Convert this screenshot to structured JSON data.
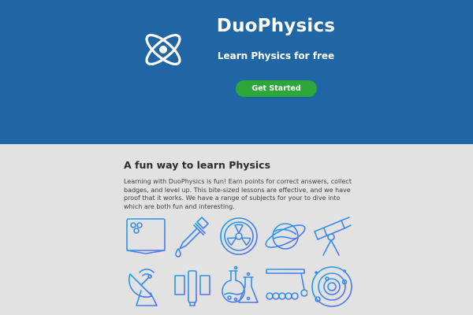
{
  "hero": {
    "brand": "DuoPhysics",
    "tagline": "Learn Physics for free",
    "cta_label": "Get Started",
    "logo_icon": "atom-icon"
  },
  "content": {
    "title": "A fun way to learn Physics",
    "intro": "Learning with DuoPhysics is fun! Earn points for correct answers, collect badges, and level up. This bite-sized lessons are effective, and we have proof that it works. We have a range of subjects for your to dive into which are both fun and interesting."
  },
  "icons": [
    "open-book-icon",
    "dropper-icon",
    "radiation-icon",
    "planet-icon",
    "telescope-icon",
    "satellite-dish-icon",
    "space-station-icon",
    "lab-flasks-icon",
    "newtons-cradle-icon",
    "solar-system-icon"
  ],
  "colors": {
    "hero_bg": "#2166a4",
    "content_bg": "#e2e2e2",
    "cta_bg": "#2ea73a",
    "icon_gradient_start": "#1aa1e8",
    "icon_gradient_end": "#5b6cf2"
  }
}
